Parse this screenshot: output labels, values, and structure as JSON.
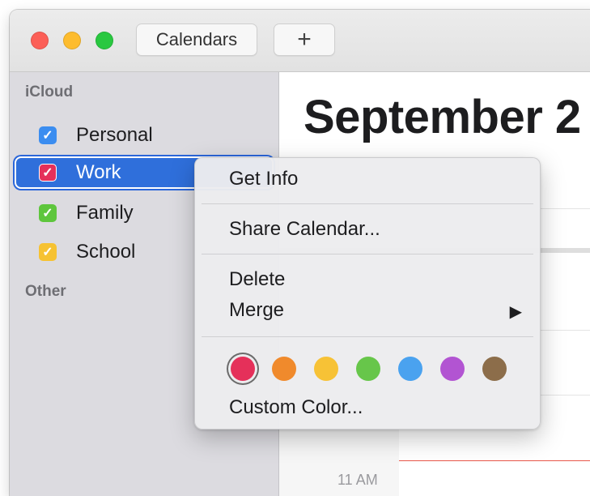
{
  "toolbar": {
    "calendars_label": "Calendars",
    "add_label": "+"
  },
  "sidebar": {
    "icloud_label": "iCloud",
    "other_label": "Other",
    "calendars": [
      {
        "label": "Personal",
        "color": "#3b8df0",
        "checked": true
      },
      {
        "label": "Work",
        "color": "#e5305a",
        "checked": true,
        "selected": true
      },
      {
        "label": "Family",
        "color": "#5ec63d",
        "checked": true
      },
      {
        "label": "School",
        "color": "#f6c232",
        "checked": true
      }
    ],
    "check_glyph": "✓",
    "chevron_glyph": "›"
  },
  "main": {
    "month_title": "September 2",
    "hour_label": "11 AM"
  },
  "context_menu": {
    "get_info": "Get Info",
    "share_calendar": "Share Calendar...",
    "delete": "Delete",
    "merge": "Merge",
    "submenu_arrow": "▶",
    "custom_color": "Custom Color...",
    "colors": [
      {
        "name": "red",
        "hex": "#e5305a",
        "selected": true
      },
      {
        "name": "orange",
        "hex": "#f08a2c"
      },
      {
        "name": "yellow",
        "hex": "#f7c236"
      },
      {
        "name": "green",
        "hex": "#67c64a"
      },
      {
        "name": "blue",
        "hex": "#4aa2ef"
      },
      {
        "name": "purple",
        "hex": "#b254d2"
      },
      {
        "name": "brown",
        "hex": "#8c6d4a"
      }
    ]
  },
  "colors": {
    "selection_blue": "#2f6fdb",
    "sidebar_bg": "#dcdbe0"
  }
}
